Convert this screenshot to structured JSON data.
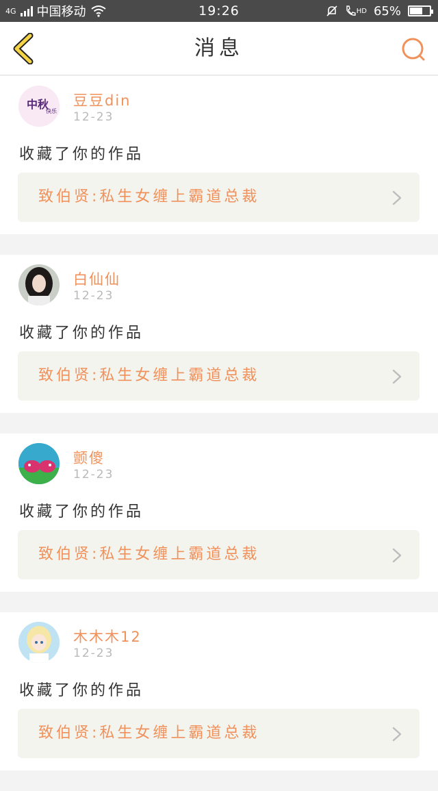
{
  "status_bar": {
    "network": "4G",
    "carrier": "中国移动",
    "time": "19:26",
    "hd_label": "HD",
    "battery_percent": "65%",
    "battery_level": 0.65
  },
  "header": {
    "title": "消息"
  },
  "colors": {
    "accent": "#f0915b",
    "back_arrow": "#f5d547",
    "status_bar_bg": "#4a4a4a",
    "card_box_bg": "#f4f4ef"
  },
  "messages": [
    {
      "username": "豆豆din",
      "time": "12-23",
      "action": "收藏了你的作品",
      "work_title": "致伯贤:私生女缠上霸道总裁",
      "avatar_icon": "mid-autumn-avatar"
    },
    {
      "username": "白仙仙",
      "time": "12-23",
      "action": "收藏了你的作品",
      "work_title": "致伯贤:私生女缠上霸道总裁",
      "avatar_icon": "girl-photo-avatar"
    },
    {
      "username": "颤傻",
      "time": "12-23",
      "action": "收藏了你的作品",
      "work_title": "致伯贤:私生女缠上霸道总裁",
      "avatar_icon": "cartoon-fish-avatar"
    },
    {
      "username": "木木木12",
      "time": "12-23",
      "action": "收藏了你的作品",
      "work_title": "致伯贤:私生女缠上霸道总裁",
      "avatar_icon": "anime-girl-avatar"
    }
  ]
}
